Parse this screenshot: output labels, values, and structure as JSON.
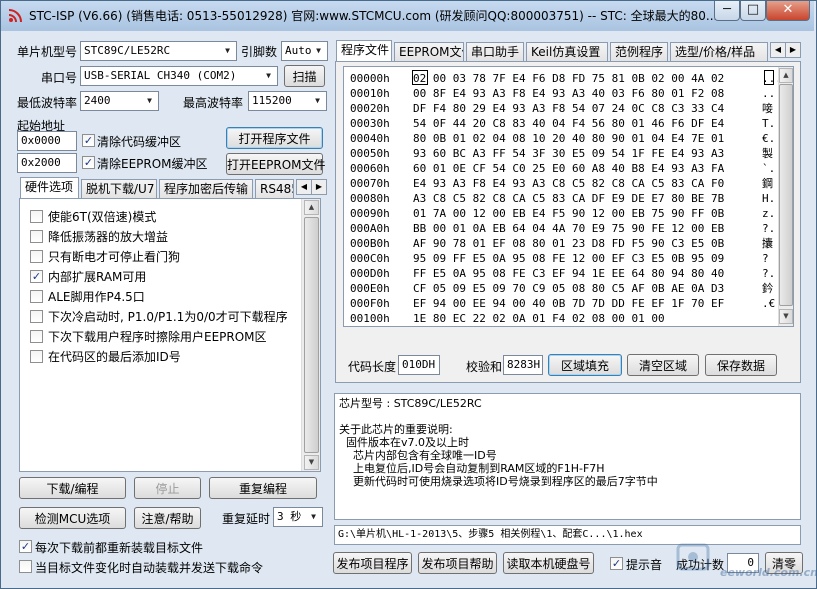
{
  "window": {
    "title": "STC-ISP (V6.66) (销售电话: 0513-55012928) 官网:www.STCMCU.com  (研发顾问QQ:800003751)  -- STC: 全球最大的80...",
    "controls": {
      "minimize": "─",
      "maximize": "□",
      "close": "✕"
    }
  },
  "left": {
    "mcu_label": "单片机型号",
    "mcu_value": "STC89C/LE52RC",
    "pins_label": "引脚数",
    "pins_value": "Auto",
    "port_label": "串口号",
    "port_value": "USB-SERIAL CH340 (COM2)",
    "scan_button": "扫描",
    "min_baud_label": "最低波特率",
    "min_baud_value": "2400",
    "max_baud_label": "最高波特率",
    "max_baud_value": "115200",
    "start_addr_label": "起始地址",
    "addr1_value": "0x0000",
    "addr2_value": "0x2000",
    "clear_code_label": "清除代码缓冲区",
    "clear_eeprom_label": "清除EEPROM缓冲区",
    "open_program_button": "打开程序文件",
    "open_eeprom_button": "打开EEPROM文件",
    "option_tabs": [
      "硬件选项",
      "脱机下载/U7",
      "程序加密后传输",
      "RS485"
    ],
    "options": [
      {
        "label": "使能6T(双倍速)模式",
        "checked": false
      },
      {
        "label": "降低振荡器的放大增益",
        "checked": false
      },
      {
        "label": "只有断电才可停止看门狗",
        "checked": false
      },
      {
        "label": "内部扩展RAM可用",
        "checked": true
      },
      {
        "label": "ALE脚用作P4.5口",
        "checked": false
      },
      {
        "label": "下次冷启动时, P1.0/P1.1为0/0才可下载程序",
        "checked": false
      },
      {
        "label": "下次下载用户程序时擦除用户EEPROM区",
        "checked": false
      },
      {
        "label": "在代码区的最后添加ID号",
        "checked": false
      }
    ],
    "download_button": "下载/编程",
    "stop_button": "停止",
    "reprogram_button": "重复编程",
    "detect_button": "检测MCU选项",
    "help_button": "注意/帮助",
    "repeat_delay_label": "重复延时",
    "repeat_delay_value": "3 秒",
    "reload_label": "每次下载前都重新装载目标文件",
    "reload_checked": true,
    "auto_load_label": "当目标文件变化时自动装载并发送下载命令",
    "auto_load_checked": false
  },
  "right": {
    "tabs": [
      "程序文件",
      "EEPROM文件",
      "串口助手",
      "Keil仿真设置",
      "范例程序",
      "选型/价格/样品"
    ],
    "hex_rows": [
      {
        "addr": "00000h",
        "bytes": "02 00 03 78 7F E4 F6 D8 FD 75 81 0B 02 00 4A 02",
        "ascii": "..."
      },
      {
        "addr": "00010h",
        "bytes": "00 8F E4 93 A3 F8 E4 93 A3 40 03 F6 80 01 F2 08",
        "ascii": ".."
      },
      {
        "addr": "00020h",
        "bytes": "DF F4 80 29 E4 93 A3 F8 54 07 24 0C C8 C3 33 C4",
        "ascii": "唼"
      },
      {
        "addr": "00030h",
        "bytes": "54 0F 44 20 C8 83 40 04 F4 56 80 01 46 F6 DF E4",
        "ascii": "T."
      },
      {
        "addr": "00040h",
        "bytes": "80 0B 01 02 04 08 10 20 40 80 90 01 04 E4 7E 01",
        "ascii": "€."
      },
      {
        "addr": "00050h",
        "bytes": "93 60 BC A3 FF 54 3F 30 E5 09 54 1F FE E4 93 A3",
        "ascii": "製"
      },
      {
        "addr": "00060h",
        "bytes": "60 01 0E CF 54 C0 25 E0 60 A8 40 B8 E4 93 A3 FA",
        "ascii": "`."
      },
      {
        "addr": "00070h",
        "bytes": "E4 93 A3 F8 E4 93 A3 C8 C5 82 C8 CA C5 83 CA F0",
        "ascii": "鋼"
      },
      {
        "addr": "00080h",
        "bytes": "A3 C8 C5 82 C8 CA C5 83 CA DF E9 DE E7 80 BE 7B",
        "ascii": "H."
      },
      {
        "addr": "00090h",
        "bytes": "01 7A 00 12 00 EB E4 F5 90 12 00 EB 75 90 FF 0B",
        "ascii": "z."
      },
      {
        "addr": "000A0h",
        "bytes": "BB 00 01 0A EB 64 04 4A 70 E9 75 90 FE 12 00 EB",
        "ascii": "?."
      },
      {
        "addr": "000B0h",
        "bytes": "AF 90 78 01 EF 08 80 01 23 D8 FD F5 90 C3 E5 0B",
        "ascii": "攮"
      },
      {
        "addr": "000C0h",
        "bytes": "95 09 FF E5 0A 95 08 FE 12 00 EF C3 E5 0B 95 09",
        "ascii": "?"
      },
      {
        "addr": "000D0h",
        "bytes": "FF E5 0A 95 08 FE C3 EF 94 1E EE 64 80 94 80 40",
        "ascii": ""
      },
      {
        "addr": "000E0h",
        "bytes": "CF 05 09 E5 09 70 C9 05 08 80 C5 AF 0B AE 0A D3",
        "ascii": "?."
      },
      {
        "addr": "000F0h",
        "bytes": "EF 94 00 EE 94 00 40 0B 7D 7D DD FE EF 1F 70 EF",
        "ascii": "鈐"
      },
      {
        "addr": "00100h",
        "bytes": "1E 80 EC 22 02 0A 01 F4 02 08 00 01 00",
        "ascii": ".€"
      }
    ],
    "code_length_label": "代码长度",
    "code_length_value": "010DH",
    "checksum_label": "校验和",
    "checksum_value": "8283H",
    "fill_button": "区域填充",
    "clear_area_button": "清空区域",
    "save_button": "保存数据",
    "info_lines": [
      "芯片型号 : STC89C/LE52RC",
      "",
      "关于此芯片的重要说明:",
      "  固件版本在v7.0及以上时",
      "    芯片内部包含有全球唯一ID号",
      "    上电复位后,ID号会自动复制到RAM区域的F1H-F7H",
      "    更新代码时可使用烧录选项将ID号烧录到程序区的最后7字节中"
    ],
    "file_path": "G:\\单片机\\HL-1-2013\\5、步骤5 相关例程\\1、配套C...\\1.hex",
    "publish_button": "发布项目程序",
    "publish_help_button": "发布项目帮助",
    "read_disk_button": "读取本机硬盘号",
    "beep_label": "提示音",
    "beep_checked": true,
    "success_label": "成功计数",
    "success_count": "0",
    "clear_count_button": "清零"
  },
  "watermark": "eeworld.com.cn"
}
